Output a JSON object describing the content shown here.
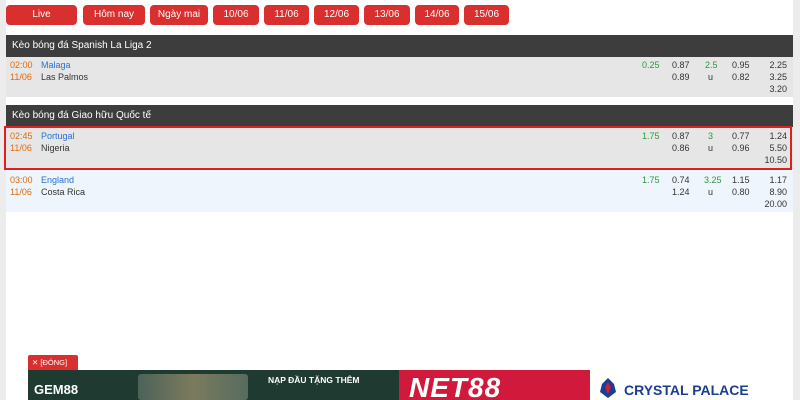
{
  "tabs": [
    "Live",
    "Hôm nay",
    "Ngày mai",
    "10/06",
    "11/06",
    "12/06",
    "13/06",
    "14/06",
    "15/06"
  ],
  "sections": [
    {
      "title": "Kèo bóng đá Spanish La Liga 2"
    },
    {
      "title": "Kèo bóng đá Giao hữu Quốc tế"
    }
  ],
  "matches": [
    {
      "time": "02:00",
      "date": "11/06",
      "home": "Malaga",
      "away": "Las Palmos",
      "hcap": "0.25",
      "hcap_home": "0.87",
      "hcap_away": "0.89",
      "ou": "2.5",
      "ou_label": "u",
      "ou_over": "0.95",
      "ou_under": "0.82",
      "x12": [
        "2.25",
        "3.25",
        "3.20"
      ]
    },
    {
      "time": "02:45",
      "date": "11/06",
      "home": "Portugal",
      "away": "Nigeria",
      "hcap": "1.75",
      "hcap_home": "0.87",
      "hcap_away": "0.86",
      "ou": "3",
      "ou_label": "u",
      "ou_over": "0.77",
      "ou_under": "0.96",
      "x12": [
        "1.24",
        "5.50",
        "10.50"
      ]
    },
    {
      "time": "03:00",
      "date": "11/06",
      "home": "England",
      "away": "Costa Rica",
      "hcap": "1.75",
      "hcap_home": "0.74",
      "hcap_away": "1.24",
      "ou": "3.25",
      "ou_label": "u",
      "ou_over": "1.15",
      "ou_under": "0.80",
      "x12": [
        "1.17",
        "8.90",
        "20.00"
      ]
    }
  ],
  "ad": {
    "close_label": "✕ [ĐÓNG]",
    "gem_logo": "GEM88",
    "gem_promo": "NẠP ĐẦU TẶNG THÊM",
    "net_logo": "NET88",
    "cp_logo": "CRYSTAL PALACE"
  },
  "colors": {
    "accent": "#d9302f",
    "header": "#3d3d3d",
    "highlight": "#e02020"
  }
}
